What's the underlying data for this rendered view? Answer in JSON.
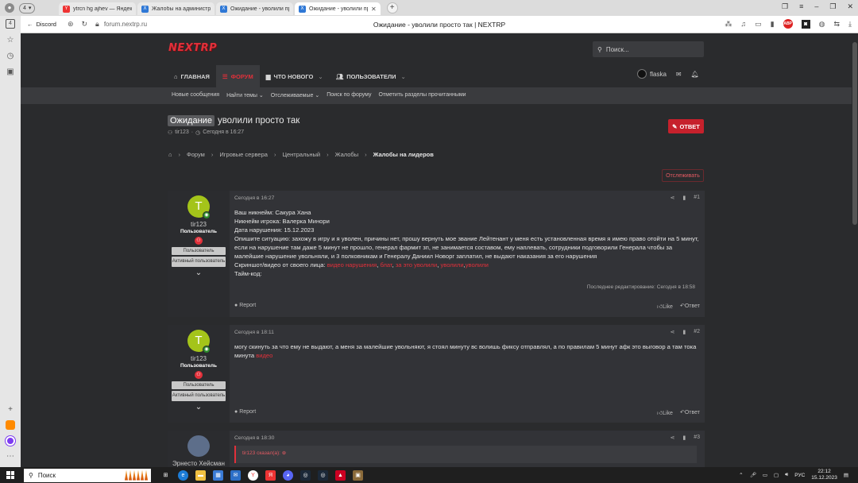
{
  "browser": {
    "tab_count": "4",
    "tabs": [
      {
        "title": "ytrcn hg ajhev — Яндекс:",
        "fav": "Y"
      },
      {
        "title": "Жалобы на администрац",
        "fav": "X"
      },
      {
        "title": "Ожидание - уволили про",
        "fav": "X"
      },
      {
        "title": "Ожидание - уволили пр",
        "fav": "X"
      }
    ],
    "back_label": "Discord",
    "url": "forum.nextrp.ru",
    "page_title": "Ожидание - уволили просто так | NEXTRP"
  },
  "site": {
    "logo": "NEXTRP",
    "search_placeholder": "Поиск...",
    "nav": [
      "ГЛАВНАЯ",
      "ФОРУМ",
      "ЧТО НОВОГО",
      "ПОЛЬЗОВАТЕЛИ"
    ],
    "username": "flaska",
    "subnav": [
      "Новые сообщения",
      "Найти темы",
      "Отслеживаемые",
      "Поиск по форуму",
      "Отметить разделы прочитанными"
    ]
  },
  "thread": {
    "prefix": "Ожидание",
    "title": "уволили просто так",
    "author": "tir123",
    "date": "Сегодня в 16:27",
    "reply_label": "ОТВЕТ",
    "breadcrumbs": [
      "Форум",
      "Игровые сервера",
      "Центральный",
      "Жалобы",
      "Жалобы на лидеров"
    ],
    "watch_label": "Отслеживать"
  },
  "posts": [
    {
      "author": "tir123",
      "avatar_letter": "T",
      "user_title": "Пользователь",
      "role1": "Пользователь",
      "role2": "Активный пользователь",
      "date": "Сегодня в 16:27",
      "num": "#1",
      "lines": {
        "l1": "Ваш никнейм: Сакура Хана",
        "l2": "Никнейм игрока: Валерка Минори",
        "l3": "Дата нарушения: 15.12.2023",
        "l4": "Опишите ситуацию: захожу в игру и я уволен, причины нет, прошу вернуть мое звание Лейтенант у меня есть установленная время я имею право отойти на 5 минут, если на нарушение там даже 5 минут не прошло, генерал фармит зп, не занимается составом, ему наплевать, сотрудники подговорили Генерала чтобы за малейшие нарушение увольняли, и 3 полковникам и Генералу Даниил Новорг заплатил, не выдают наказания за его нарушения",
        "l5": "Скриншот/видео от своего лица:",
        "links": [
          "видео нарушения",
          "блат",
          "за это уволили",
          "уволили",
          "уволили"
        ],
        "l6": "Тайм-код:"
      },
      "edited": "Последнее редактирование: Сегодня в 18:58",
      "report": "Report",
      "like": "Like",
      "reply": "Ответ"
    },
    {
      "author": "tir123",
      "avatar_letter": "T",
      "user_title": "Пользователь",
      "role1": "Пользователь",
      "role2": "Активный пользователь",
      "date": "Сегодня в 18:11",
      "num": "#2",
      "text": "могу скинуть за что ему не выдают, а меня за малейшие увольняют, я стоял минуту вс волишь фиксу отправлял, а по правилам 5 минут афк это выговор а там тока минута",
      "link": "видео",
      "report": "Report",
      "like": "Like",
      "reply": "Ответ"
    },
    {
      "author": "Эрнесто Хейсман",
      "date": "Сегодня в 18:30",
      "num": "#3",
      "quote": "tir123 сказал(а): ⊕"
    }
  ],
  "taskbar": {
    "search": "Поиск",
    "lang": "РУС",
    "time": "22:12",
    "date": "15.12.2023"
  },
  "colors": {
    "accent": "#e1303a",
    "background": "#2a2b2d",
    "panel": "#323337"
  }
}
